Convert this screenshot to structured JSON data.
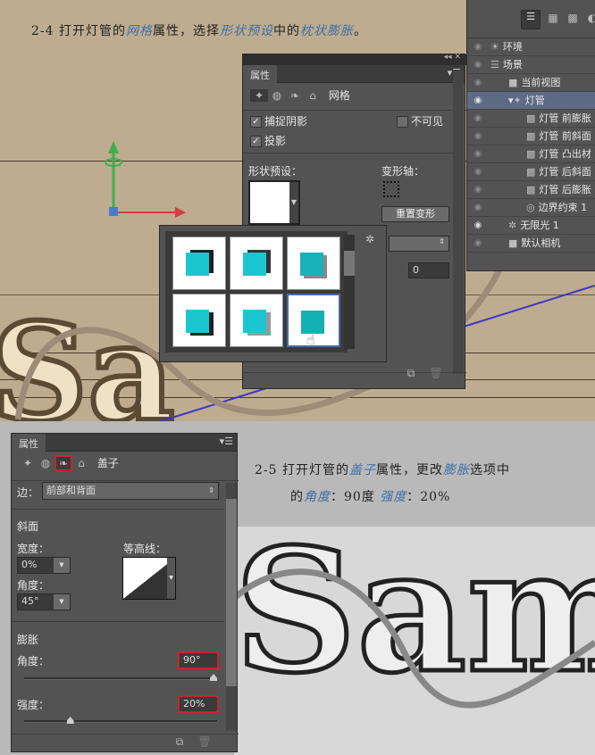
{
  "caption_top": {
    "prefix": "2-4 打开灯管的",
    "h1": "网格",
    "mid1": "属性，选择",
    "h2": "形状预设",
    "mid2": "中的",
    "h3": "枕状膨胀",
    "end": "。"
  },
  "layers": {
    "items": [
      {
        "label": "环境",
        "icon": "environment-icon",
        "visible": false
      },
      {
        "label": "场景",
        "icon": "scene-icon",
        "visible": false
      },
      {
        "label": "当前视图",
        "icon": "camera-icon",
        "visible": false
      },
      {
        "label": "灯管",
        "icon": "mesh-icon",
        "visible": true,
        "selected": true
      },
      {
        "label": "灯管 前膨胀",
        "icon": "material-icon",
        "visible": false
      },
      {
        "label": "灯管 前斜面",
        "icon": "material-icon",
        "visible": false
      },
      {
        "label": "灯管 凸出材",
        "icon": "material-icon",
        "visible": false
      },
      {
        "label": "灯管 后斜面",
        "icon": "material-icon",
        "visible": false
      },
      {
        "label": "灯管 后膨胀",
        "icon": "material-icon",
        "visible": false
      },
      {
        "label": "边界约束 1",
        "icon": "constraint-icon",
        "visible": false
      },
      {
        "label": "无限光 1",
        "icon": "light-icon",
        "visible": true
      },
      {
        "label": "默认相机",
        "icon": "camera-icon",
        "visible": false
      }
    ]
  },
  "props_top": {
    "tab": "属性",
    "section": "网格",
    "catch_shadows": "捕捉阴影",
    "cast_shadows": "投影",
    "invisible": "不可见",
    "shape_preset": "形状预设：",
    "deform_axis": "变形轴：",
    "reset": "重置变形",
    "value": "0"
  },
  "props_bottom": {
    "tab": "属性",
    "section": "盖子",
    "side_label": "边：",
    "side_value": "前部和背面",
    "bevel": "斜面",
    "width_label": "宽度：",
    "width_value": "0%",
    "angle_label": "角度：",
    "angle_value": "45°",
    "contour_label": "等高线：",
    "inflate": "膨胀",
    "inflate_angle_label": "角度：",
    "inflate_angle_value": "90°",
    "strength_label": "强度：",
    "strength_value": "20%",
    "inflate_angle_fraction": 1.0,
    "strength_fraction": 0.2
  },
  "caption_bottom": {
    "l1a": "2-5 打开灯管的",
    "h1": "盖子",
    "l1b": "属性，更改",
    "h2": "膨胀",
    "l1c": "选项中",
    "l2a": "的",
    "h3": "角度",
    "l2b": "：90度  ",
    "h4": "强度",
    "l2c": "：20%"
  },
  "render_text": "Sam"
}
